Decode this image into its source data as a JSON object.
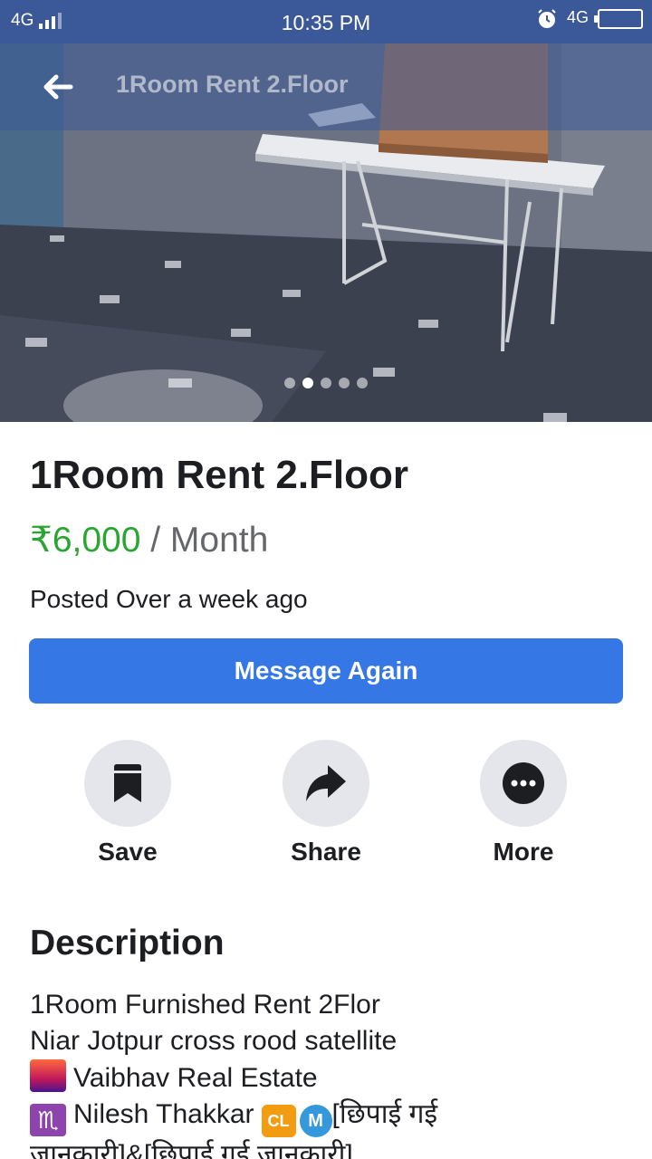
{
  "status_bar": {
    "network_left": "4G",
    "time": "10:35 PM",
    "network_right": "4G"
  },
  "header": {
    "title": "1Room Rent 2.Floor",
    "back_icon": "arrow-left-icon"
  },
  "carousel": {
    "count": 5,
    "active_index": 1
  },
  "listing": {
    "title": "1Room Rent 2.Floor",
    "price": "₹6,000",
    "period": " / Month",
    "posted": "Posted Over a week ago",
    "message_button": "Message Again"
  },
  "actions": {
    "save": "Save",
    "share": "Share",
    "more": "More"
  },
  "description": {
    "heading": "Description",
    "line1": "1Room Furnished Rent 2Flor",
    "line2": "Niar Jotpur cross rood satellite",
    "line3": "Vaibhav Real Estate",
    "line4_name": "Nilesh Thakkar",
    "line4_badge_cl": "CL",
    "line4_badge_m": "M",
    "line4_rest": "[छिपाई गई",
    "line5": "जानकारी]&[छिपाई गई जानकारी]"
  },
  "colors": {
    "status_bar": "#3b5998",
    "price_green": "#2aa532",
    "button_blue": "#3578e5",
    "circle_gray": "#e4e6eb"
  }
}
